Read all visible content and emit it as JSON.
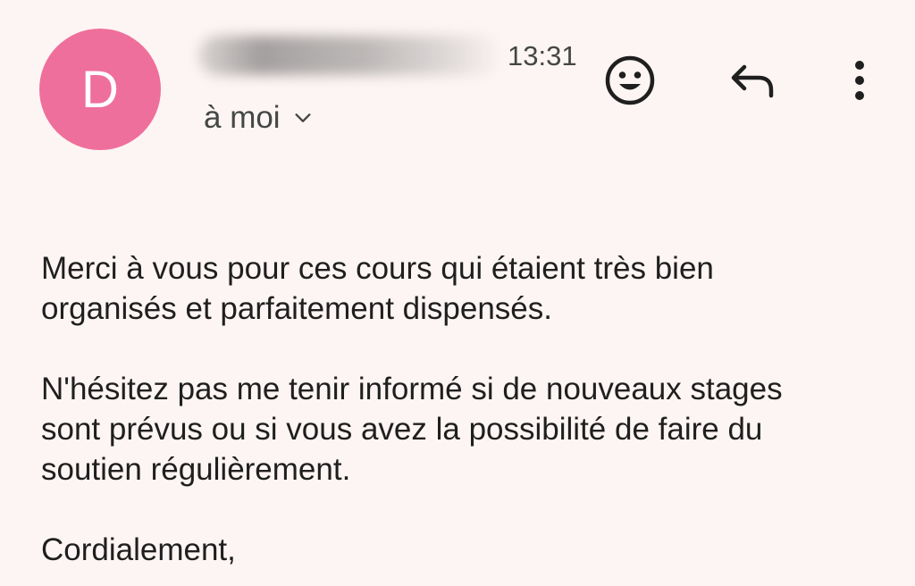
{
  "email": {
    "avatar_letter": "D",
    "avatar_color": "#ef6f9c",
    "time": "13:31",
    "recipient": "à moi",
    "icons": {
      "emoji": "smiley-face-icon",
      "reply": "reply-arrow-icon",
      "more": "more-vertical-icon",
      "expand": "chevron-down-icon"
    },
    "body": {
      "line1": "Merci à vous pour ces cours qui étaient très bien",
      "line2": "organisés et parfaitement dispensés.",
      "line3": "N'hésitez pas me tenir informé si de nouveaux stages",
      "line4": "sont prévus ou si vous avez la possibilité de faire du",
      "line5": "soutien régulièrement.",
      "line6": "Cordialement,"
    }
  }
}
